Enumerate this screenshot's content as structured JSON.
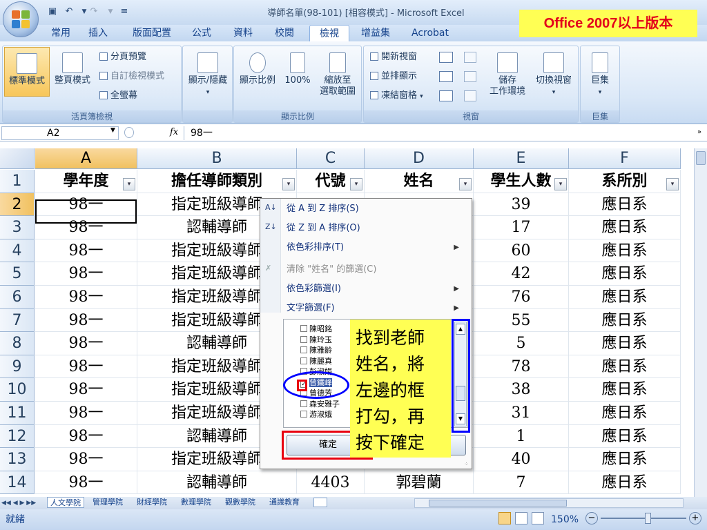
{
  "window": {
    "title": "導師名單(98-101)  [相容模式] - Microsoft Excel"
  },
  "badge": {
    "text": "Office 2007以上版本"
  },
  "colors": {
    "badge_bg": "#ffff54",
    "badge_fg": "#e3001b",
    "highlight_red": "#e8000f",
    "highlight_blue": "#0000ff",
    "selected_header": "#f1c15f"
  },
  "tabs": [
    "常用",
    "插入",
    "版面配置",
    "公式",
    "資料",
    "校閱",
    "檢視",
    "增益集",
    "Acrobat"
  ],
  "active_tab": "檢視",
  "ribbon": {
    "workbook_views": {
      "label": "活頁簿檢視",
      "normal": "標準模式",
      "page_layout": "整頁模式",
      "page_break": "分頁預覽",
      "custom_views": "自訂檢視模式",
      "full_screen": "全螢幕"
    },
    "show_hide": {
      "button": "顯示/隱藏"
    },
    "zoom": {
      "label": "顯示比例",
      "zoom": "顯示比例",
      "hundred": "100%",
      "to_selection_1": "縮放至",
      "to_selection_2": "選取範圍"
    },
    "window": {
      "label": "視窗",
      "new_window": "開新視窗",
      "arrange": "並排顯示",
      "freeze": "凍結窗格",
      "save_ws_1": "儲存",
      "save_ws_2": "工作環境",
      "switch": "切換視窗"
    },
    "macros": {
      "label": "巨集",
      "button": "巨集"
    }
  },
  "formula_bar": {
    "name_box": "A2",
    "fx": "fx",
    "value": "98一"
  },
  "columns": [
    "A",
    "B",
    "C",
    "D",
    "E",
    "F"
  ],
  "header_row": {
    "num": "1",
    "cells": [
      "學年度",
      "擔任導師類別",
      "代號",
      "姓名",
      "學生人數",
      "系所別"
    ]
  },
  "rows": [
    {
      "num": "2",
      "a": "98一",
      "b": "指定班級導師",
      "c": "",
      "d": "",
      "e": "39",
      "f": "應日系"
    },
    {
      "num": "3",
      "a": "98一",
      "b": "認輔導師",
      "c": "",
      "d": "",
      "e": "17",
      "f": "應日系"
    },
    {
      "num": "4",
      "a": "98一",
      "b": "指定班級導師",
      "c": "",
      "d": "",
      "e": "60",
      "f": "應日系"
    },
    {
      "num": "5",
      "a": "98一",
      "b": "指定班級導師",
      "c": "",
      "d": "",
      "e": "42",
      "f": "應日系"
    },
    {
      "num": "6",
      "a": "98一",
      "b": "指定班級導師",
      "c": "",
      "d": "",
      "e": "76",
      "f": "應日系"
    },
    {
      "num": "7",
      "a": "98一",
      "b": "指定班級導師",
      "c": "",
      "d": "",
      "e": "55",
      "f": "應日系"
    },
    {
      "num": "8",
      "a": "98一",
      "b": "認輔導師",
      "c": "",
      "d": "",
      "e": "5",
      "f": "應日系"
    },
    {
      "num": "9",
      "a": "98一",
      "b": "指定班級導師",
      "c": "",
      "d": "",
      "e": "78",
      "f": "應日系"
    },
    {
      "num": "10",
      "a": "98一",
      "b": "指定班級導師",
      "c": "",
      "d": "",
      "e": "38",
      "f": "應日系"
    },
    {
      "num": "11",
      "a": "98一",
      "b": "指定班級導師",
      "c": "",
      "d": "",
      "e": "31",
      "f": "應日系"
    },
    {
      "num": "12",
      "a": "98一",
      "b": "認輔導師",
      "c": "",
      "d": "",
      "e": "1",
      "f": "應日系"
    },
    {
      "num": "13",
      "a": "98一",
      "b": "指定班級導師",
      "c": "",
      "d": "",
      "e": "40",
      "f": "應日系"
    },
    {
      "num": "14",
      "a": "98一",
      "b": "認輔導師",
      "c": "4403",
      "d": "郭碧蘭",
      "e": "7",
      "f": "應日系"
    }
  ],
  "filter_menu": {
    "sort_az": "從 A 到 Z 排序(S)",
    "sort_za": "從 Z 到 A 排序(O)",
    "sort_color": "依色彩排序(T)",
    "clear_filter": "清除 \"姓名\" 的篩選(C)",
    "filter_color": "依色彩篩選(I)",
    "text_filter": "文字篩選(F)",
    "names": [
      "陳昭銘",
      "陳玲玉",
      "陳雅齡",
      "陳麗真",
      "彭淑娟",
      "曾鐵峰",
      "曾德芳",
      "森安雅子",
      "游淑娥"
    ],
    "checked_index": 5,
    "ok": "確定"
  },
  "instruction": {
    "lines": [
      "找到老師",
      "姓名，將",
      "左邊的框",
      "打勾，再",
      "按下確定"
    ]
  },
  "sheet_tabs": [
    "人文學院",
    "管理學院",
    "財經學院",
    "數理學院",
    "觀數學院",
    "通識教育"
  ],
  "status": {
    "ready": "就緒",
    "zoom": "150%"
  }
}
